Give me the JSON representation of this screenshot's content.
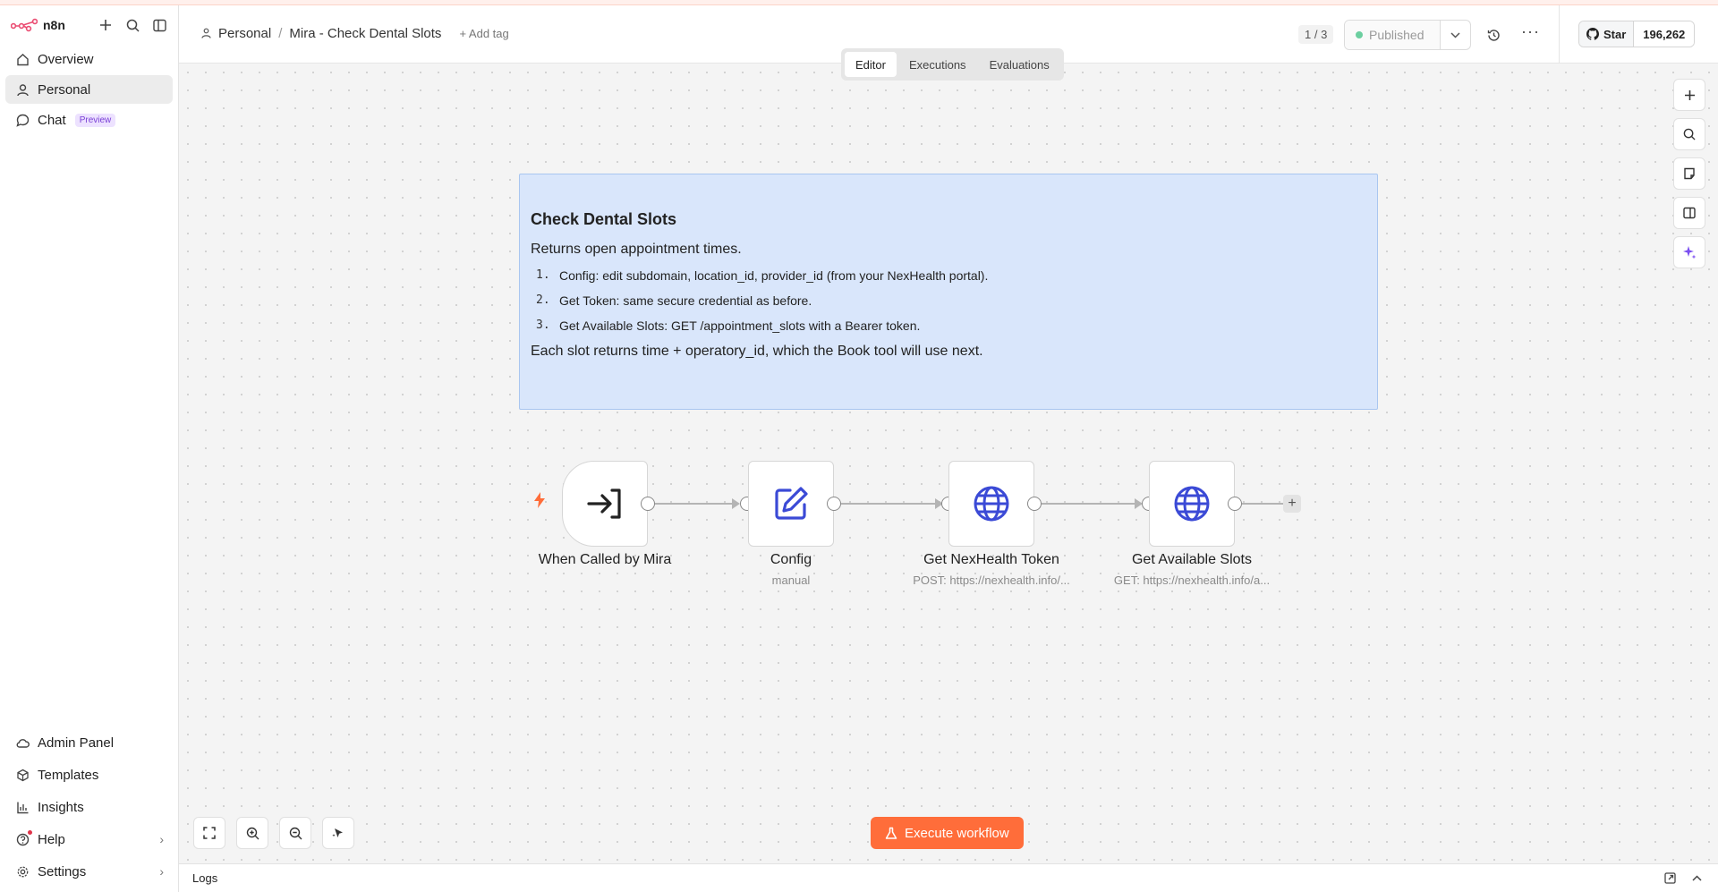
{
  "app": {
    "name": "n8n"
  },
  "sidebar": {
    "items": [
      {
        "label": "Overview",
        "icon": "home-icon"
      },
      {
        "label": "Personal",
        "icon": "user-icon"
      },
      {
        "label": "Chat",
        "icon": "chat-icon",
        "badge": "Preview"
      }
    ],
    "bottom_items": [
      {
        "label": "Admin Panel",
        "icon": "cloud-icon"
      },
      {
        "label": "Templates",
        "icon": "box-icon"
      },
      {
        "label": "Insights",
        "icon": "chart-icon"
      },
      {
        "label": "Help",
        "icon": "help-icon"
      },
      {
        "label": "Settings",
        "icon": "gear-icon"
      }
    ]
  },
  "header": {
    "breadcrumb_project": "Personal",
    "breadcrumb_sep": "/",
    "workflow_name": "Mira - Check Dental Slots",
    "add_tag": "+ Add tag",
    "pager": "1 / 3",
    "status": "Published",
    "github_star": "Star",
    "github_count": "196,262"
  },
  "tabs": [
    "Editor",
    "Executions",
    "Evaluations"
  ],
  "note": {
    "title": "Check Dental Slots",
    "intro": "Returns open appointment times.",
    "steps": [
      {
        "num": "1.",
        "text": "Config: edit subdomain, location_id, provider_id (from your NexHealth portal)."
      },
      {
        "num": "2.",
        "text": "Get Token: same secure credential as before."
      },
      {
        "num": "3.",
        "text": "Get Available Slots: GET /appointment_slots with a Bearer token."
      }
    ],
    "outro": "Each slot returns time + operatory_id, which the Book tool will use next."
  },
  "nodes": [
    {
      "name": "When Called by Mira",
      "subtitle": ""
    },
    {
      "name": "Config",
      "subtitle": "manual"
    },
    {
      "name": "Get NexHealth Token",
      "subtitle": "POST: https://nexhealth.info/..."
    },
    {
      "name": "Get Available Slots",
      "subtitle": "GET: https://nexhealth.info/a..."
    }
  ],
  "execute_button": "Execute workflow",
  "logs": {
    "label": "Logs"
  },
  "colors": {
    "accent": "#ff6d3a",
    "note_bg": "#d9e6fb",
    "node_icon": "#3b4ad6"
  }
}
